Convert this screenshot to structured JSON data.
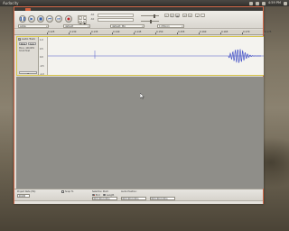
{
  "top_panel": {
    "app_name": "Audacity",
    "clock": "4:59 PM"
  },
  "toolbar": {
    "transport": [
      {
        "name": "pause-button",
        "glyph": "❚❚"
      },
      {
        "name": "play-button",
        "glyph": "▶"
      },
      {
        "name": "stop-button",
        "glyph": "■"
      },
      {
        "name": "skip-start-button",
        "glyph": "⏮"
      },
      {
        "name": "skip-end-button",
        "glyph": "⏭"
      },
      {
        "name": "record-button",
        "glyph": "●"
      }
    ],
    "tools": [
      "I",
      "↔",
      "✎",
      "✱",
      "↕",
      "🔍"
    ],
    "meter_labels": {
      "output": "-60",
      "input": "-60"
    },
    "device_host": "ALSA",
    "device_output": "default",
    "device_input": "default: Mic",
    "channels": "1 (Mono)"
  },
  "timeline": {
    "ticks": [
      "0.125",
      "0.130",
      "0.135",
      "0.140",
      "0.145",
      "0.150",
      "0.155",
      "0.160",
      "0.165",
      "0.170",
      "0.175"
    ]
  },
  "track": {
    "name": "Audio Track",
    "rate": "Mono, 44100Hz",
    "format": "32-bit float",
    "mute_label": "Mute",
    "solo_label": "Solo",
    "vruler_labels": [
      "1.0",
      "0.5",
      "0.0",
      "-0.5",
      "-1.0"
    ]
  },
  "selection_toolbar": {
    "project_rate_label": "Project Rate (Hz):",
    "project_rate": "44100",
    "snap_label": "Snap To",
    "selection_start_label": "Selection Start:",
    "end_label": "End",
    "length_label": "Length",
    "audio_position_label": "Audio Position:",
    "selection_start": "00 h 00 m 00 s",
    "selection_end": "00 h 00 m 00 s",
    "audio_position": "00 h 00 m 00 s"
  },
  "colors": {
    "waveform": "#4a57c8",
    "window_border": "#d2694a",
    "track_highlight": "#d6c44a",
    "empty_project": "#8f8e89"
  }
}
